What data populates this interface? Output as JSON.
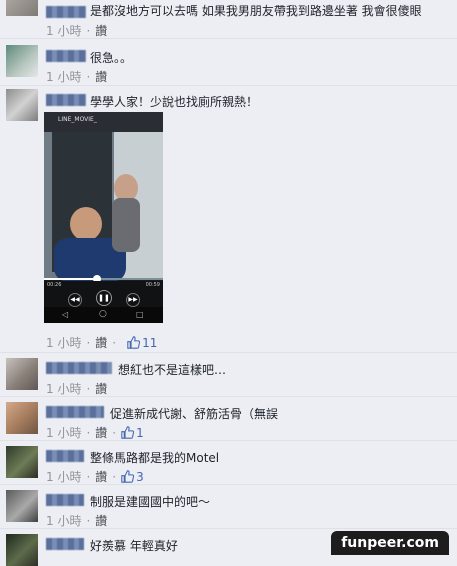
{
  "comments": [
    {
      "text": "是都沒地方可以去嗎 如果我男朋友帶我到路邊坐著 我會很傻眼",
      "time": "1 小時",
      "like_label": "讚"
    },
    {
      "text": "很急。。",
      "time": "1 小時",
      "like_label": "讚"
    },
    {
      "text": "學學人家！少說也找廁所親熱！",
      "time": "1 小時",
      "like_label": "讚",
      "likes": "11"
    },
    {
      "text": "想紅也不是這樣吧…",
      "time": "1 小時",
      "like_label": "讚"
    },
    {
      "text": "促進新成代謝、舒筋活骨（無誤",
      "time": "1 小時",
      "like_label": "讚",
      "likes": "1"
    },
    {
      "text": "整條馬路都是我的Motel",
      "time": "1 小時",
      "like_label": "讚",
      "likes": "3"
    },
    {
      "text": "制服是建國國中的吧～",
      "time": "1 小時",
      "like_label": "讚"
    },
    {
      "text": "好羨慕 年輕真好"
    }
  ],
  "video": {
    "title": "LINE_MOVIE_",
    "elapsed": "00:26",
    "duration": "00:59",
    "progress": 0.45
  },
  "watermark": "funpeer.com",
  "colors": {
    "background": "#eceef3",
    "link": "#4267b2",
    "meta": "#90949c"
  },
  "icons": [
    "like-thumb-icon",
    "play-pause-icon",
    "rewind-icon",
    "fast-forward-icon",
    "back-icon",
    "home-icon",
    "recent-apps-icon"
  ]
}
